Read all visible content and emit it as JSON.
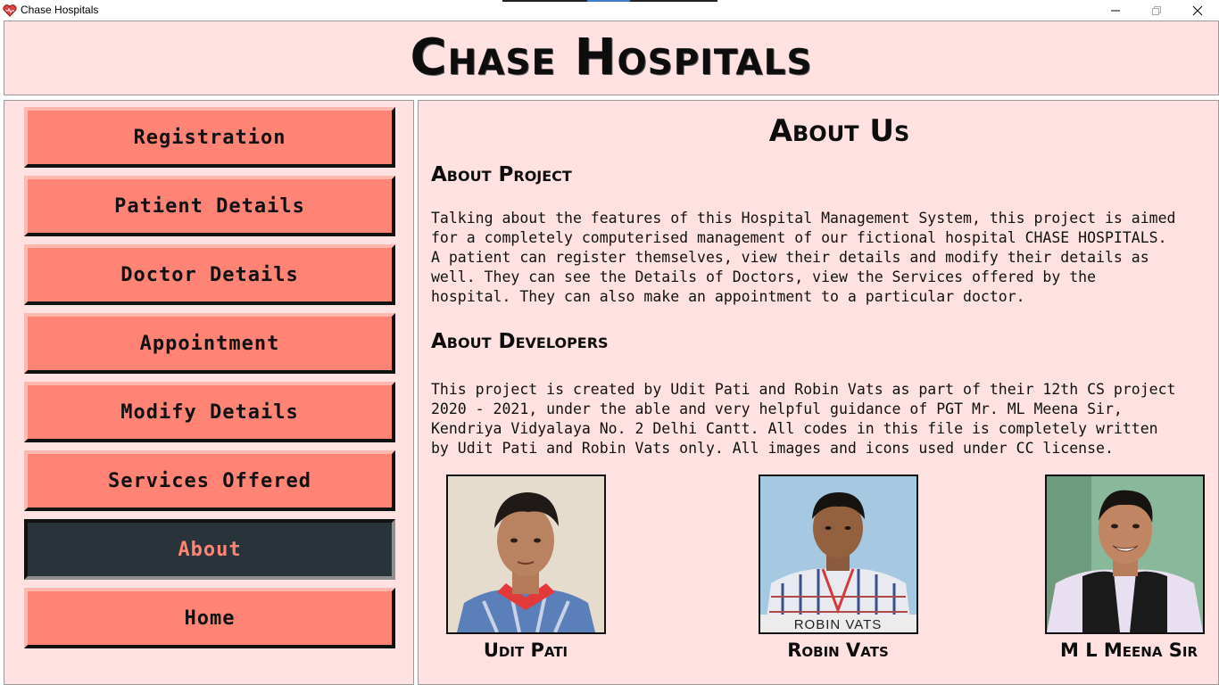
{
  "window": {
    "title": "Chase Hospitals"
  },
  "header": {
    "title": "Chase Hospitals"
  },
  "sidebar": {
    "items": [
      {
        "label": "Registration"
      },
      {
        "label": "Patient Details"
      },
      {
        "label": "Doctor Details"
      },
      {
        "label": "Appointment"
      },
      {
        "label": "Modify Details"
      },
      {
        "label": "Services Offered"
      },
      {
        "label": "About",
        "active": true
      },
      {
        "label": "Home"
      }
    ]
  },
  "main": {
    "heading": "About Us",
    "project": {
      "heading": "About Project",
      "text": "Talking about the features of this Hospital Management System, this project is aimed\nfor a completely computerised management of our fictional hospital CHASE HOSPITALS.\nA patient can register themselves, view their details and modify their details as\nwell. They can see the Details of Doctors, view the Services offered by the\nhospital. They can also make an appointment to a particular doctor."
    },
    "developers": {
      "heading": "About Developers",
      "text": "This project is created by Udit Pati and Robin Vats as part of their 12th CS project\n2020 - 2021, under the able and very helpful guidance of PGT Mr. ML Meena Sir,\nKendriya Vidyalaya No. 2 Delhi Cantt. All codes in this file is completely written\nby Udit Pati and Robin Vats only. All images and icons used under CC license."
    },
    "people": [
      {
        "name": "Udit Pati"
      },
      {
        "name": "Robin Vats",
        "photo_caption": "ROBIN VATS"
      },
      {
        "name": "M L Meena Sir"
      }
    ]
  },
  "colors": {
    "background": "#ffe1e1",
    "button": "#ff8476",
    "button_active": "#29333a"
  }
}
